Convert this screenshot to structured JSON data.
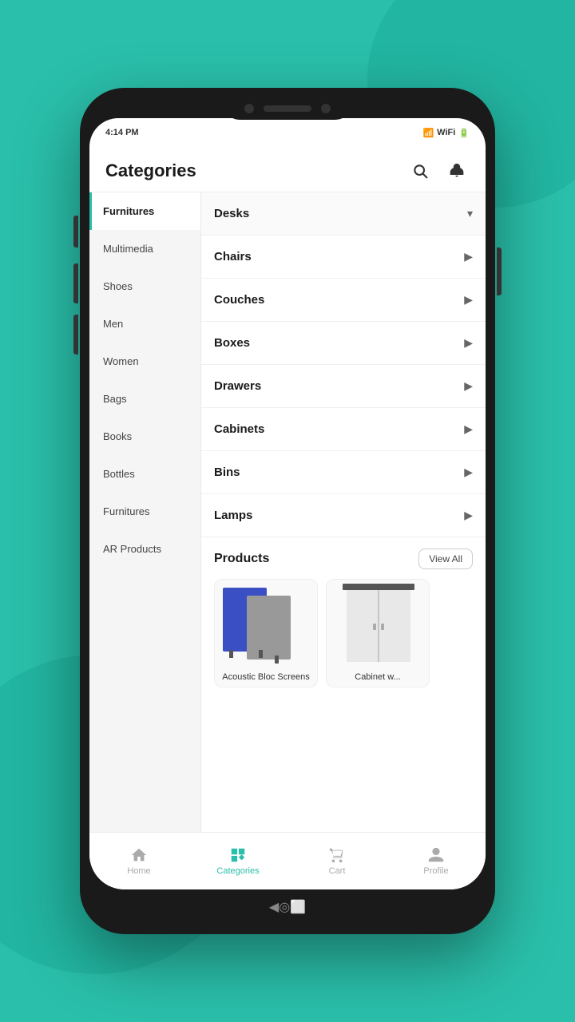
{
  "app": {
    "status_time": "4:14 PM",
    "header": {
      "title": "Categories",
      "search_label": "Search",
      "notification_label": "Notifications"
    }
  },
  "sidebar": {
    "items": [
      {
        "label": "Furnitures",
        "active": true
      },
      {
        "label": "Multimedia",
        "active": false
      },
      {
        "label": "Shoes",
        "active": false
      },
      {
        "label": "Men",
        "active": false
      },
      {
        "label": "Women",
        "active": false
      },
      {
        "label": "Bags",
        "active": false
      },
      {
        "label": "Books",
        "active": false
      },
      {
        "label": "Bottles",
        "active": false
      },
      {
        "label": "Furnitures",
        "active": false
      },
      {
        "label": "AR Products",
        "active": false
      }
    ]
  },
  "categories": [
    {
      "name": "Desks",
      "chevron": "▾",
      "expanded": true
    },
    {
      "name": "Chairs",
      "chevron": "▶",
      "expanded": false
    },
    {
      "name": "Couches",
      "chevron": "▶",
      "expanded": false
    },
    {
      "name": "Boxes",
      "chevron": "▶",
      "expanded": false
    },
    {
      "name": "Drawers",
      "chevron": "▶",
      "expanded": false
    },
    {
      "name": "Cabinets",
      "chevron": "▶",
      "expanded": false
    },
    {
      "name": "Bins",
      "chevron": "▶",
      "expanded": false
    },
    {
      "name": "Lamps",
      "chevron": "▶",
      "expanded": false
    }
  ],
  "products": {
    "title": "Products",
    "view_all": "View All",
    "items": [
      {
        "name": "Acoustic Bloc Screens"
      },
      {
        "name": "Cabinet w..."
      }
    ]
  },
  "bottom_nav": {
    "items": [
      {
        "label": "Home",
        "active": false
      },
      {
        "label": "Categories",
        "active": true
      },
      {
        "label": "Cart",
        "active": false
      },
      {
        "label": "Profile",
        "active": false
      }
    ]
  }
}
